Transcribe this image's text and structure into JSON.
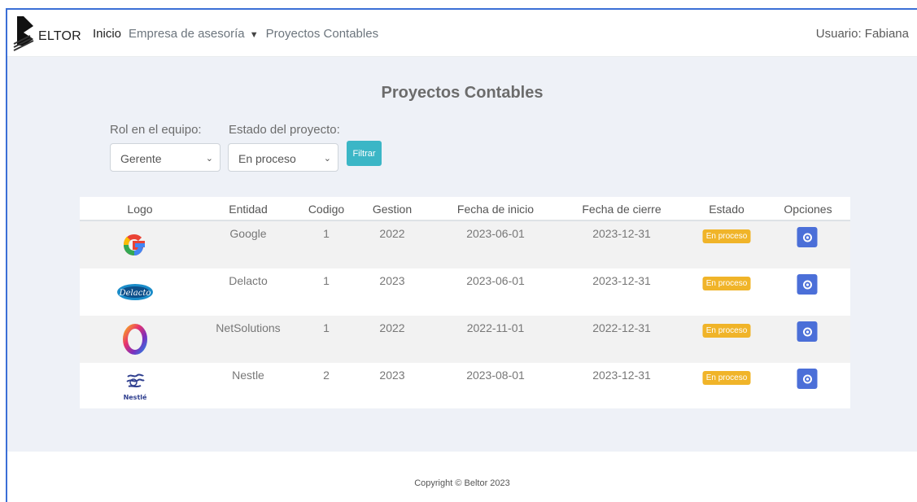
{
  "navbar": {
    "brand": "ELTOR",
    "links": [
      "Inicio",
      "Empresa de asesoría",
      "Proyectos Contables"
    ],
    "user": "Usuario: Fabiana"
  },
  "page": {
    "title": "Proyectos Contables"
  },
  "filters": {
    "rol_label": "Rol en el equipo:",
    "rol_value": "Gerente",
    "estado_label": "Estado del proyecto:",
    "estado_value": "En proceso",
    "button": "Filtrar"
  },
  "table": {
    "headers": [
      "Logo",
      "Entidad",
      "Codigo",
      "Gestion",
      "Fecha de inicio",
      "Fecha de cierre",
      "Estado",
      "Opciones"
    ],
    "rows": [
      {
        "logo": "google-logo",
        "entidad": "Google",
        "codigo": "1",
        "gestion": "2022",
        "inicio": "2023-06-01",
        "cierre": "2023-12-31",
        "estado": "En proceso"
      },
      {
        "logo": "delacto-logo",
        "entidad": "Delacto",
        "codigo": "1",
        "gestion": "2023",
        "inicio": "2023-06-01",
        "cierre": "2023-12-31",
        "estado": "En proceso"
      },
      {
        "logo": "netsolutions-logo",
        "entidad": "NetSolutions",
        "codigo": "1",
        "gestion": "2022",
        "inicio": "2022-11-01",
        "cierre": "2022-12-31",
        "estado": "En proceso"
      },
      {
        "logo": "nestle-logo",
        "entidad": "Nestle",
        "codigo": "2",
        "gestion": "2023",
        "inicio": "2023-08-01",
        "cierre": "2023-12-31",
        "estado": "En proceso"
      }
    ]
  },
  "footer": {
    "copyright": "Copyright © Beltor 2023"
  },
  "colors": {
    "badge": "#f0b429",
    "action": "#4b6fd8",
    "filter": "#3bb6c6",
    "frame": "#3b6fd6"
  }
}
